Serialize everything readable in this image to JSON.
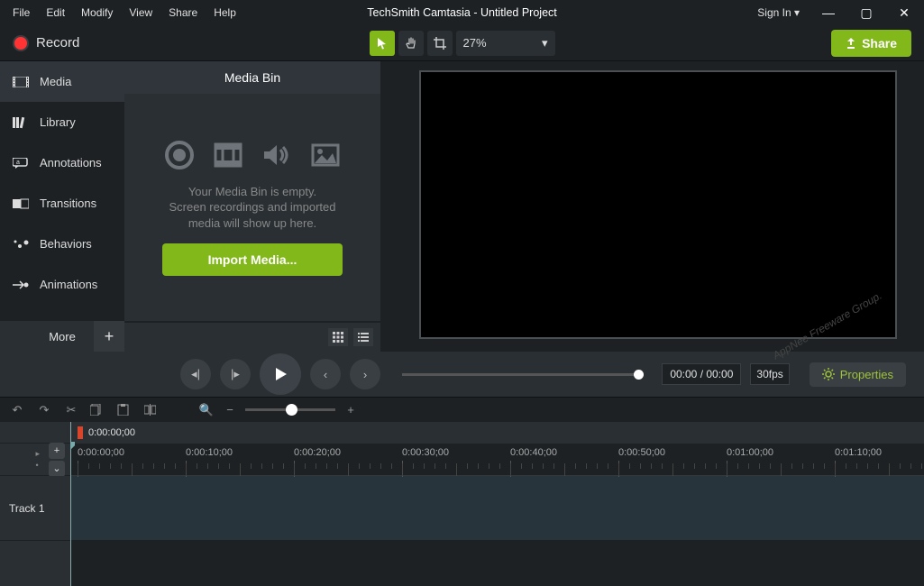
{
  "menu": {
    "items": [
      "File",
      "Edit",
      "Modify",
      "View",
      "Share",
      "Help"
    ]
  },
  "app_title": "TechSmith Camtasia - Untitled Project",
  "signin": "Sign In ▾",
  "record_label": "Record",
  "zoom_value": "27%",
  "share_label": "Share",
  "side_tabs": [
    "Media",
    "Library",
    "Annotations",
    "Transitions",
    "Behaviors",
    "Animations"
  ],
  "more_label": "More",
  "mediabin": {
    "title": "Media Bin",
    "empty_msg_l1": "Your Media Bin is empty.",
    "empty_msg_l2": "Screen recordings and imported",
    "empty_msg_l3": "media will show up here.",
    "import_btn": "Import Media..."
  },
  "playback": {
    "timecode": "00:00 / 00:00",
    "fps": "30fps"
  },
  "properties_label": "Properties",
  "timeline": {
    "marker_time": "0:00:00;00",
    "majors": [
      "0:00:00;00",
      "0:00:10;00",
      "0:00:20;00",
      "0:00:30;00",
      "0:00:40;00",
      "0:00:50;00",
      "0:01:00;00",
      "0:01:10;00"
    ],
    "track1": "Track 1"
  },
  "watermark": "AppNee Freeware Group."
}
